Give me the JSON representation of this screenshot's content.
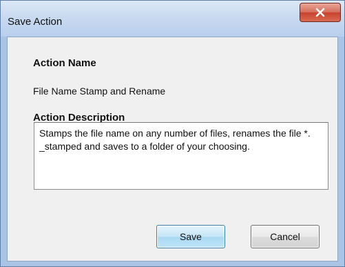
{
  "window": {
    "title": "Save Action"
  },
  "form": {
    "name_label": "Action Name",
    "name_value": "File Name Stamp and Rename",
    "description_label": "Action Description",
    "description_value": "Stamps the file name on any number of files, renames the file *. _stamped and saves to a folder of your choosing."
  },
  "buttons": {
    "save_label": "Save",
    "cancel_label": "Cancel"
  },
  "icons": {
    "close": "close-icon"
  },
  "colors": {
    "titlebar": "#c9daf0",
    "close_button": "#c7432d",
    "client_bg": "#f0f0f0",
    "default_button_border": "#3c7fb1"
  }
}
